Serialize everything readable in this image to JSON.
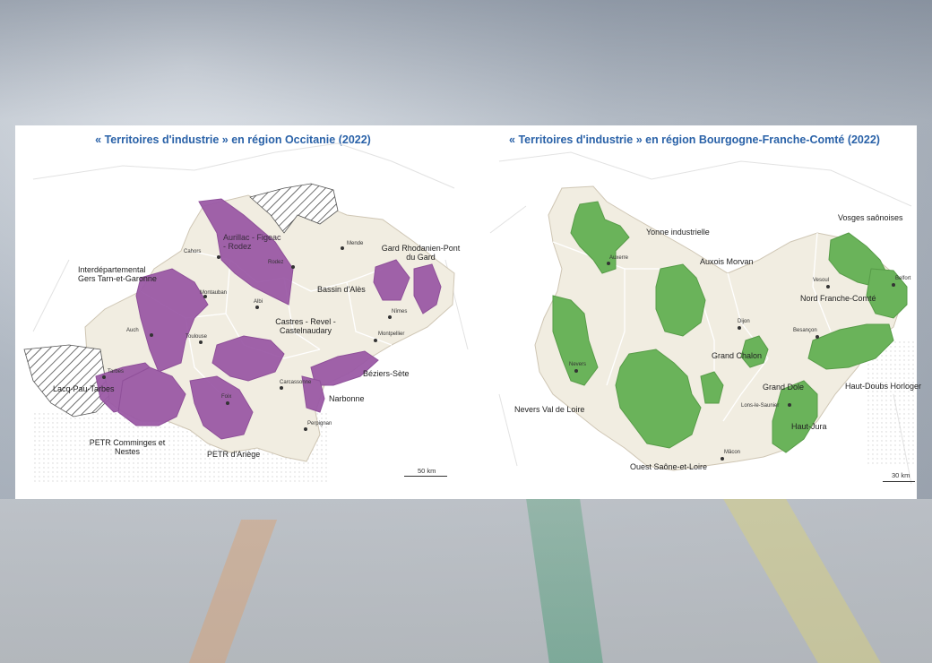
{
  "background": {
    "base_color": "#c9ccd1"
  },
  "occitanie": {
    "title": "« Territoires d'industrie » en région Occitanie (2022)",
    "territories": [
      "Aurillac - Figeac - Rodez",
      "Gard Rhodanien-Pont du Gard",
      "Interdépartemental Gers Tarn-et-Garonne",
      "Bassin d'Alès",
      "Castres - Revel - Castelnaudary",
      "Lacq-Pau-Tarbes",
      "Béziers-Sète",
      "Narbonne",
      "PETR Comminges et Nestes",
      "PETR d'Ariège"
    ],
    "cities": [
      "Cahors",
      "Mende",
      "Montauban",
      "Albi",
      "Nîmes",
      "Auch",
      "Toulouse",
      "Montpellier",
      "Tarbes",
      "Carcassonne",
      "Perpignan",
      "Foix",
      "Rodez"
    ],
    "scale": "50 km",
    "fill_color": "#9b5aa6"
  },
  "bfc": {
    "title": "« Territoires d'industrie » en région Bourgogne-Franche-Comté (2022)",
    "territories": [
      "Vosges saônoises",
      "Yonne industrielle",
      "Auxois Morvan",
      "Nord Franche-Comté",
      "Grand Chalon",
      "Grand Dole",
      "Haut-Doubs Horloger",
      "Nevers Val de Loire",
      "Haut-Jura",
      "Ouest Saône-et-Loire"
    ],
    "cities": [
      "Auxerre",
      "Vesoul",
      "Belfort",
      "Dijon",
      "Besançon",
      "Nevers",
      "Lons-le-Saunier",
      "Mâcon"
    ],
    "scale": "30 km",
    "fill_color": "#6ab35a"
  }
}
